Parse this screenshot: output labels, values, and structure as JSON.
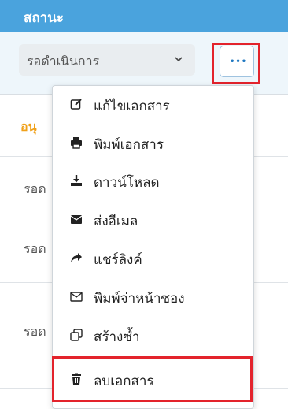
{
  "header": {
    "title": "สถานะ"
  },
  "filter": {
    "status_value": "รอดำเนินการ"
  },
  "table": {
    "badge_text": "อนุ",
    "row_labels": [
      "รอด",
      "รอด",
      "รอด"
    ]
  },
  "actions": {
    "more_label": "•••",
    "menu_items": [
      {
        "icon": "edit-icon",
        "label": "แก้ไขเอกสาร"
      },
      {
        "icon": "print-icon",
        "label": "พิมพ์เอกสาร"
      },
      {
        "icon": "download-icon",
        "label": "ดาวน์โหลด"
      },
      {
        "icon": "envelope-filled-icon",
        "label": "ส่งอีเมล"
      },
      {
        "icon": "share-icon",
        "label": "แชร์ลิงค์"
      },
      {
        "icon": "envelope-outline-icon",
        "label": "พิมพ์จ่าหน้าซอง"
      },
      {
        "icon": "copy-icon",
        "label": "สร้างซ้ำ"
      },
      {
        "icon": "trash-icon",
        "label": "ลบเอกสาร"
      }
    ]
  },
  "colors": {
    "header_bg": "#4aa3dd",
    "highlight": "#e3232c",
    "badge": "#f0a11a",
    "accent": "#1f78c1"
  }
}
